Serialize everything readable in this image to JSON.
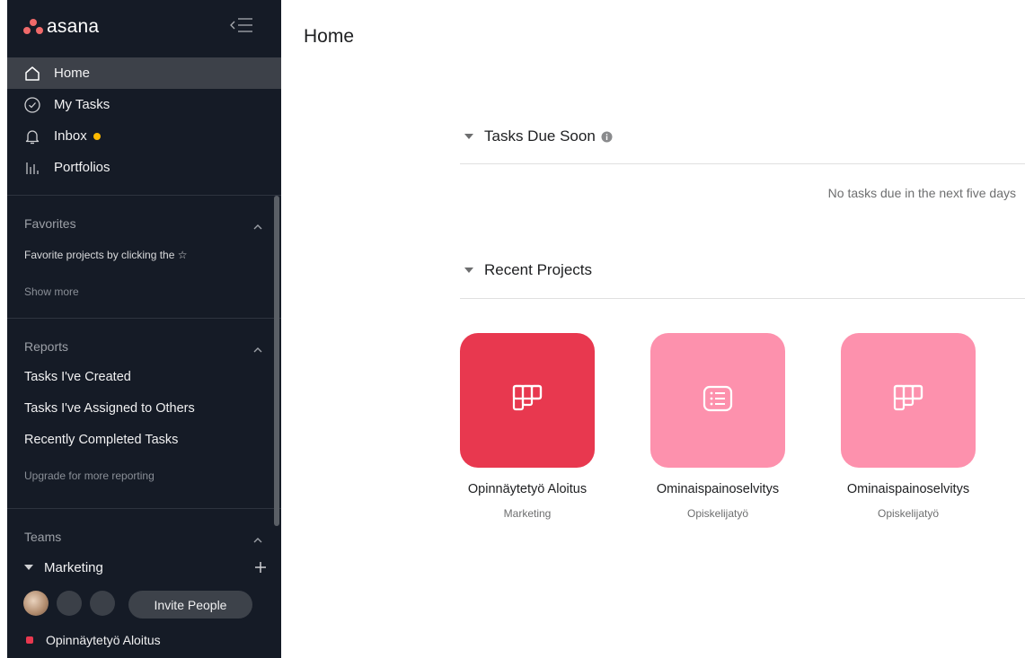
{
  "brand": {
    "name": "asana"
  },
  "nav": [
    {
      "label": "Home",
      "icon": "home-icon",
      "active": true
    },
    {
      "label": "My Tasks",
      "icon": "check-circle-icon"
    },
    {
      "label": "Inbox",
      "icon": "bell-icon"
    },
    {
      "label": "Portfolios",
      "icon": "portfolio-bars-icon"
    }
  ],
  "favorites": {
    "title": "Favorites",
    "hint": "Favorite projects by clicking the ☆",
    "show_more": "Show more"
  },
  "reports": {
    "title": "Reports",
    "items": [
      "Tasks I've Created",
      "Tasks I've Assigned to Others",
      "Recently Completed Tasks"
    ],
    "upgrade": "Upgrade for more reporting"
  },
  "teams": {
    "title": "Teams",
    "team_name": "Marketing",
    "invite_label": "Invite People",
    "project": "Opinnäytetyö Aloitus"
  },
  "main": {
    "title": "Home",
    "tasks_due_title": "Tasks Due Soon",
    "tasks_due_empty": "No tasks due in the next five days",
    "recent_title": "Recent Projects",
    "projects": [
      {
        "name": "Opinnäytetyö Aloitus",
        "team": "Marketing",
        "color": "#e8384f",
        "icon": "board-icon"
      },
      {
        "name": "Ominaispainoselvitys",
        "team": "Opiskelijatyö",
        "color": "#fd91ad",
        "icon": "list-icon"
      },
      {
        "name": "Ominaispainoselvitys",
        "team": "Opiskelijatyö",
        "color": "#fd91ad",
        "icon": "board-icon"
      }
    ]
  },
  "colors": {
    "sidebar_bg": "#151b26",
    "accent": "#f06a6a",
    "inbox_dot": "#fcb900"
  }
}
